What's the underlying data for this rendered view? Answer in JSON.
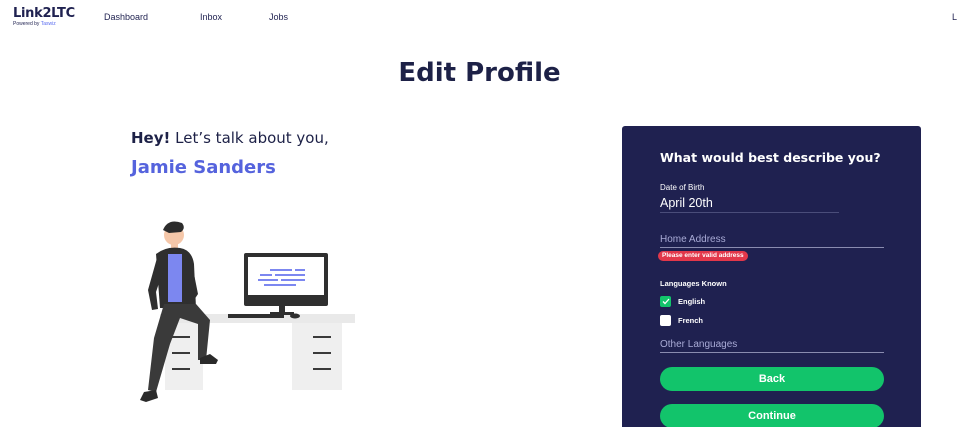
{
  "nav": {
    "logo_main": "Link2LTC",
    "logo_sub_prefix": "Powered by ",
    "logo_sub_brand": "Taswiz",
    "links": [
      "Dashboard",
      "Inbox",
      "Jobs"
    ],
    "right_cut_text": "L"
  },
  "page": {
    "title": "Edit Profile"
  },
  "intro": {
    "greeting_bold": "Hey!",
    "greeting_rest": " Let’s talk about you,",
    "name": "Jamie Sanders"
  },
  "form": {
    "title": "What would best describe you?",
    "dob_label": "Date of Birth",
    "dob_value": "April 20th",
    "address_placeholder": "Home Address",
    "address_value": "",
    "address_error": "Please enter valid address",
    "languages_label": "Languages Known",
    "languages": [
      {
        "label": "English",
        "checked": true
      },
      {
        "label": "French",
        "checked": false
      }
    ],
    "other_languages_placeholder": "Other Languages",
    "back_label": "Back",
    "continue_label": "Continue"
  },
  "colors": {
    "navy": "#1f2150",
    "accent_blue": "#5563dd",
    "green": "#12c46b",
    "error_red": "#e2374a"
  },
  "icons": {
    "illustration": "person-at-desk-illustration",
    "check": "check-icon"
  }
}
